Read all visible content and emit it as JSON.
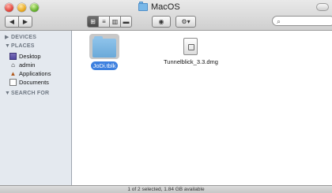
{
  "window": {
    "title": "MacOS"
  },
  "toolbar": {
    "back_icon": "◀",
    "forward_icon": "▶",
    "view_buttons": [
      "⊞",
      "≡",
      "▥",
      "▬"
    ],
    "eye_label": "◉",
    "gear_label": "⚙▾",
    "search": {
      "placeholder": "",
      "icon": "magnifier-icon"
    }
  },
  "sidebar": {
    "sections": {
      "devices": "DEVICES",
      "places": "PLACES",
      "search_for": "SEARCH FOR"
    },
    "items": [
      {
        "label": "Desktop"
      },
      {
        "label": "admin"
      },
      {
        "label": "Applications"
      },
      {
        "label": "Documents"
      }
    ]
  },
  "files": [
    {
      "name": "JoDi.tblk",
      "selected": true
    },
    {
      "name": "Tunnelblick_3.3.dmg",
      "selected": false
    }
  ],
  "status": {
    "text": "1 of 2 selected, 1.84 GB available"
  },
  "colors": {
    "selection": "#3d80df",
    "sidebar_bg": "#e4e9ef",
    "folder": "#6aa9d9"
  }
}
